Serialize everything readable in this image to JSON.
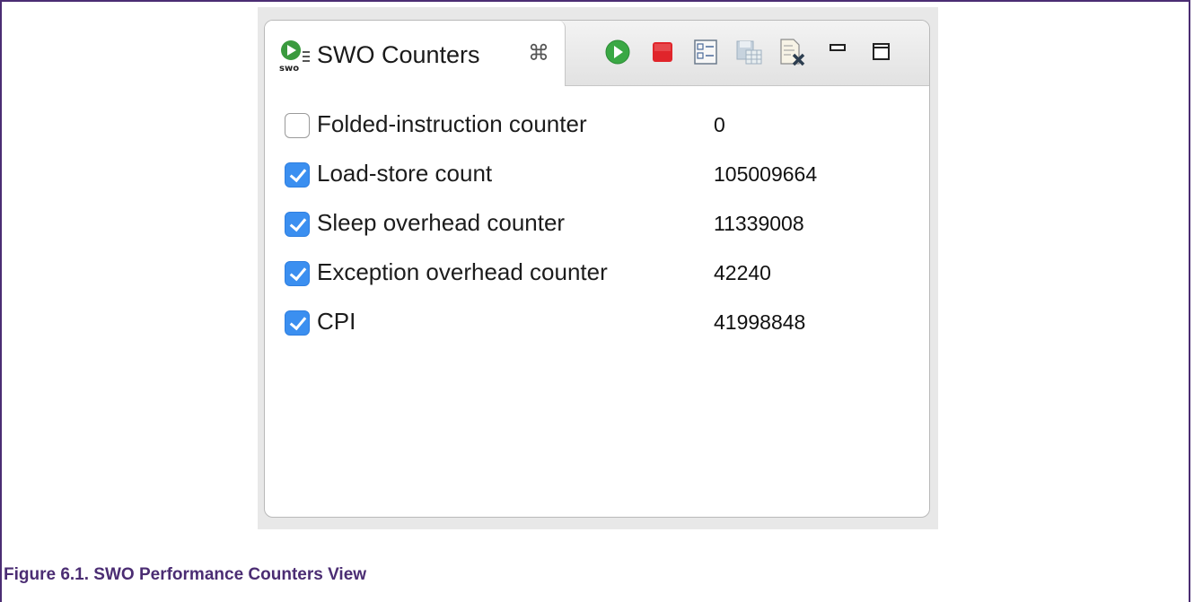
{
  "view": {
    "tab_title": "SWO Counters",
    "tab_close": "⌘",
    "toolbar": [
      {
        "name": "start-icon",
        "color": "#3aa844"
      },
      {
        "name": "stop-icon",
        "color": "#e0252b"
      },
      {
        "name": "select-counters-icon"
      },
      {
        "name": "save-icon"
      },
      {
        "name": "clear-icon"
      },
      {
        "name": "minimize-icon"
      },
      {
        "name": "maximize-icon"
      }
    ],
    "counters": [
      {
        "label": "Folded-instruction counter",
        "value": "0",
        "checked": false
      },
      {
        "label": "Load-store count",
        "value": "105009664",
        "checked": true
      },
      {
        "label": "Sleep overhead counter",
        "value": "11339008",
        "checked": true
      },
      {
        "label": "Exception overhead counter",
        "value": "42240",
        "checked": true
      },
      {
        "label": "CPI",
        "value": "41998848",
        "checked": true
      }
    ]
  },
  "caption": "Figure 6.1. SWO Performance Counters View",
  "colors": {
    "accent": "#4b2d73",
    "checkbox": "#3b8ff0"
  }
}
